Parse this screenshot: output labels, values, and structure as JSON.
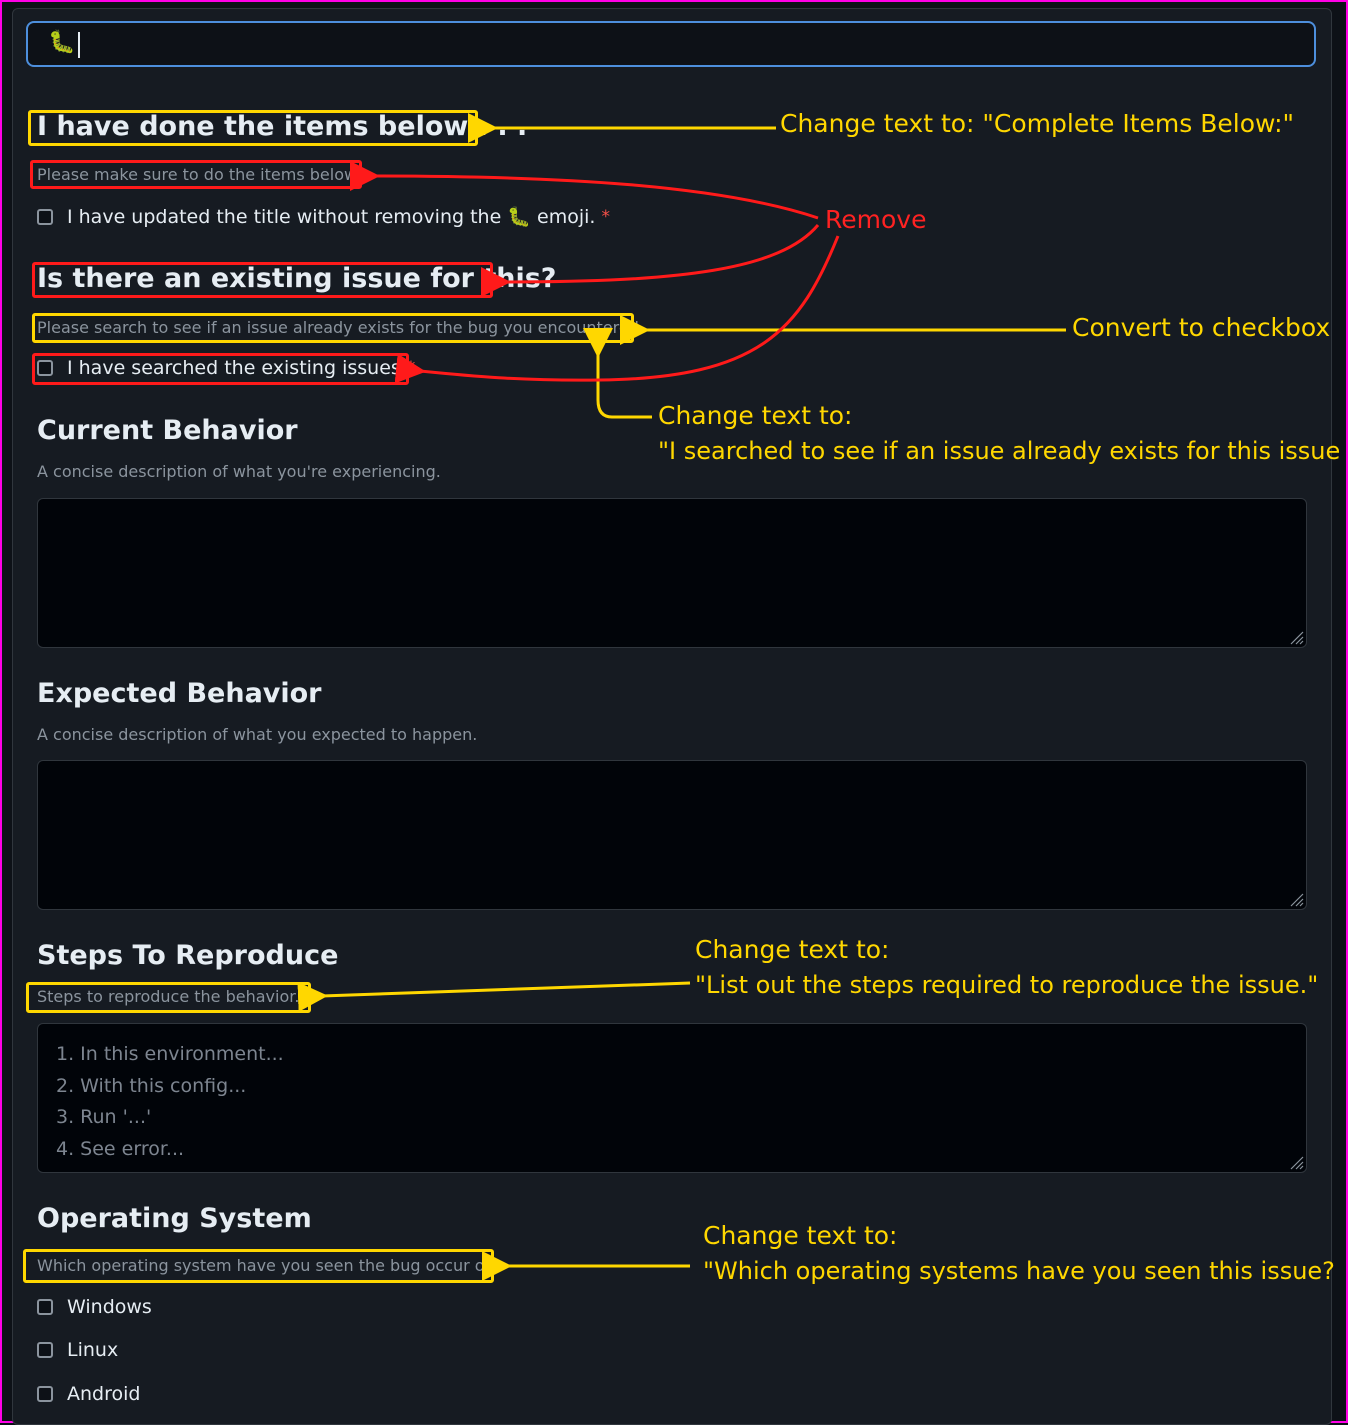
{
  "title_input": {
    "value": "🐛"
  },
  "sections": {
    "done_items": {
      "heading": "I have done the items below . . .",
      "description": "Please make sure to do the items below.",
      "checkbox_label": "I have updated the title without removing the 🐛 emoji.",
      "required_mark": "*"
    },
    "existing_issue": {
      "heading": "Is there an existing issue for this?",
      "description": "Please search to see if an issue already exists for the bug you encountered.",
      "checkbox_label": "I have searched the existing issues",
      "required_mark": "*"
    },
    "current_behavior": {
      "heading": "Current Behavior",
      "description": "A concise description of what you're experiencing."
    },
    "expected_behavior": {
      "heading": "Expected Behavior",
      "description": "A concise description of what you expected to happen."
    },
    "steps": {
      "heading": "Steps To Reproduce",
      "description": "Steps to reproduce the behavior.",
      "placeholder_lines": [
        "1. In this environment...",
        "2. With this config...",
        "3. Run '...'",
        "4. See error..."
      ]
    },
    "os": {
      "heading": "Operating System",
      "description": "Which operating system have you seen the bug occur on",
      "options": [
        "Windows",
        "Linux",
        "Android"
      ]
    }
  },
  "annotations": {
    "change_heading": "Change text to: \"Complete Items Below:\"",
    "remove": "Remove",
    "convert": "Convert to checkbox",
    "change_search_line1": "Change text to:",
    "change_search_line2": "\"I searched to see if an issue already exists for this issue",
    "change_steps_line1": "Change text to:",
    "change_steps_line2": "\"List out the steps required to reproduce the issue.\"",
    "change_os_line1": "Change text to:",
    "change_os_line2": "\"Which operating systems have you seen this issue?"
  },
  "colors": {
    "annotation_yellow": "#ffd700",
    "annotation_red": "#ff1a1a",
    "frame_magenta": "#ff00e6",
    "focus_blue": "#4d8fdd"
  }
}
